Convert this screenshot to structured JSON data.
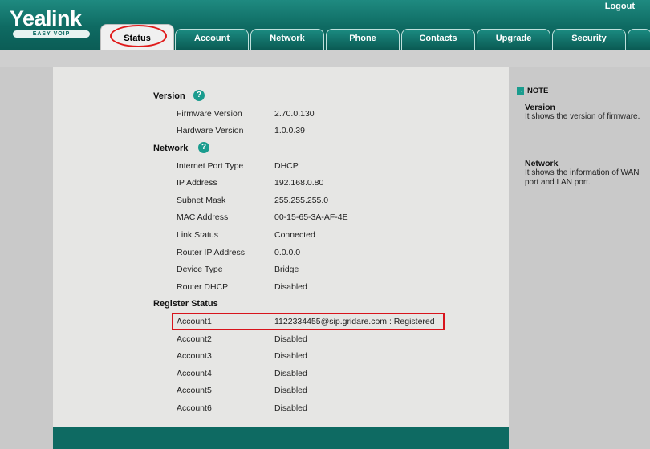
{
  "header": {
    "logo": "Yealink",
    "logo_sub": "EASY VOIP",
    "logout": "Logout"
  },
  "tabs": [
    {
      "label": "Status",
      "active": true
    },
    {
      "label": "Account"
    },
    {
      "label": "Network"
    },
    {
      "label": "Phone"
    },
    {
      "label": "Contacts"
    },
    {
      "label": "Upgrade"
    },
    {
      "label": "Security"
    }
  ],
  "sections": {
    "version": {
      "title": "Version",
      "rows": [
        {
          "label": "Firmware Version",
          "value": "2.70.0.130"
        },
        {
          "label": "Hardware Version",
          "value": "1.0.0.39"
        }
      ]
    },
    "network": {
      "title": "Network",
      "rows": [
        {
          "label": "Internet Port Type",
          "value": "DHCP"
        },
        {
          "label": "IP Address",
          "value": "192.168.0.80"
        },
        {
          "label": "Subnet Mask",
          "value": "255.255.255.0"
        },
        {
          "label": "MAC Address",
          "value": "00-15-65-3A-AF-4E"
        },
        {
          "label": "Link Status",
          "value": "Connected"
        },
        {
          "label": "Router IP Address",
          "value": "0.0.0.0"
        },
        {
          "label": "Device Type",
          "value": "Bridge"
        },
        {
          "label": "Router DHCP",
          "value": "Disabled"
        }
      ]
    },
    "register": {
      "title": "Register Status",
      "rows": [
        {
          "label": "Account1",
          "value": "1122334455@sip.gridare.com : Registered"
        },
        {
          "label": "Account2",
          "value": "Disabled"
        },
        {
          "label": "Account3",
          "value": "Disabled"
        },
        {
          "label": "Account4",
          "value": "Disabled"
        },
        {
          "label": "Account5",
          "value": "Disabled"
        },
        {
          "label": "Account6",
          "value": "Disabled"
        }
      ]
    }
  },
  "help_glyph": "?",
  "note": {
    "heading": "NOTE",
    "icon_glyph": "→",
    "items": [
      {
        "title": "Version",
        "text": "It shows the version of firmware."
      },
      {
        "title": "Network",
        "text": "It shows the information of WAN port and LAN port."
      }
    ]
  },
  "colors": {
    "header_teal": "#0e6a62",
    "highlight_red": "#d8141c",
    "help_teal": "#1a9c8e"
  }
}
